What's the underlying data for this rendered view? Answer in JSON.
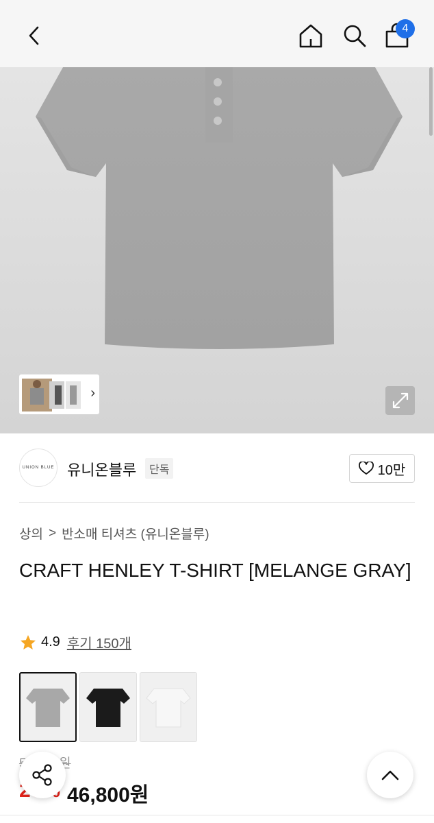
{
  "nav": {
    "back_icon": "chevron-left-icon",
    "home_icon": "home-icon",
    "search_icon": "search-icon",
    "cart_icon": "shopping-bag-icon",
    "cart_count": "4"
  },
  "gallery": {
    "expand_icon": "expand-icon",
    "thumb_arrow": "›"
  },
  "brand": {
    "logo_text": "UNION BLUE",
    "name": "유니온블루",
    "tag": "단독",
    "like_icon": "heart-icon",
    "like_count": "10만"
  },
  "breadcrumb": {
    "category": "상의",
    "separator": ">",
    "subcategory": "반소매 티셔츠 (유니온블루)"
  },
  "product": {
    "title": "CRAFT HENLEY T-SHIRT [MELANGE GRAY]",
    "rating": "4.9",
    "reviews": "후기 150개",
    "original_price": "58,500원",
    "discount": "20%",
    "sale_price": "46,800원"
  },
  "colors": {
    "accent": "#1f6fe8",
    "discount_red": "#e0241b",
    "star": "#f5a623"
  }
}
